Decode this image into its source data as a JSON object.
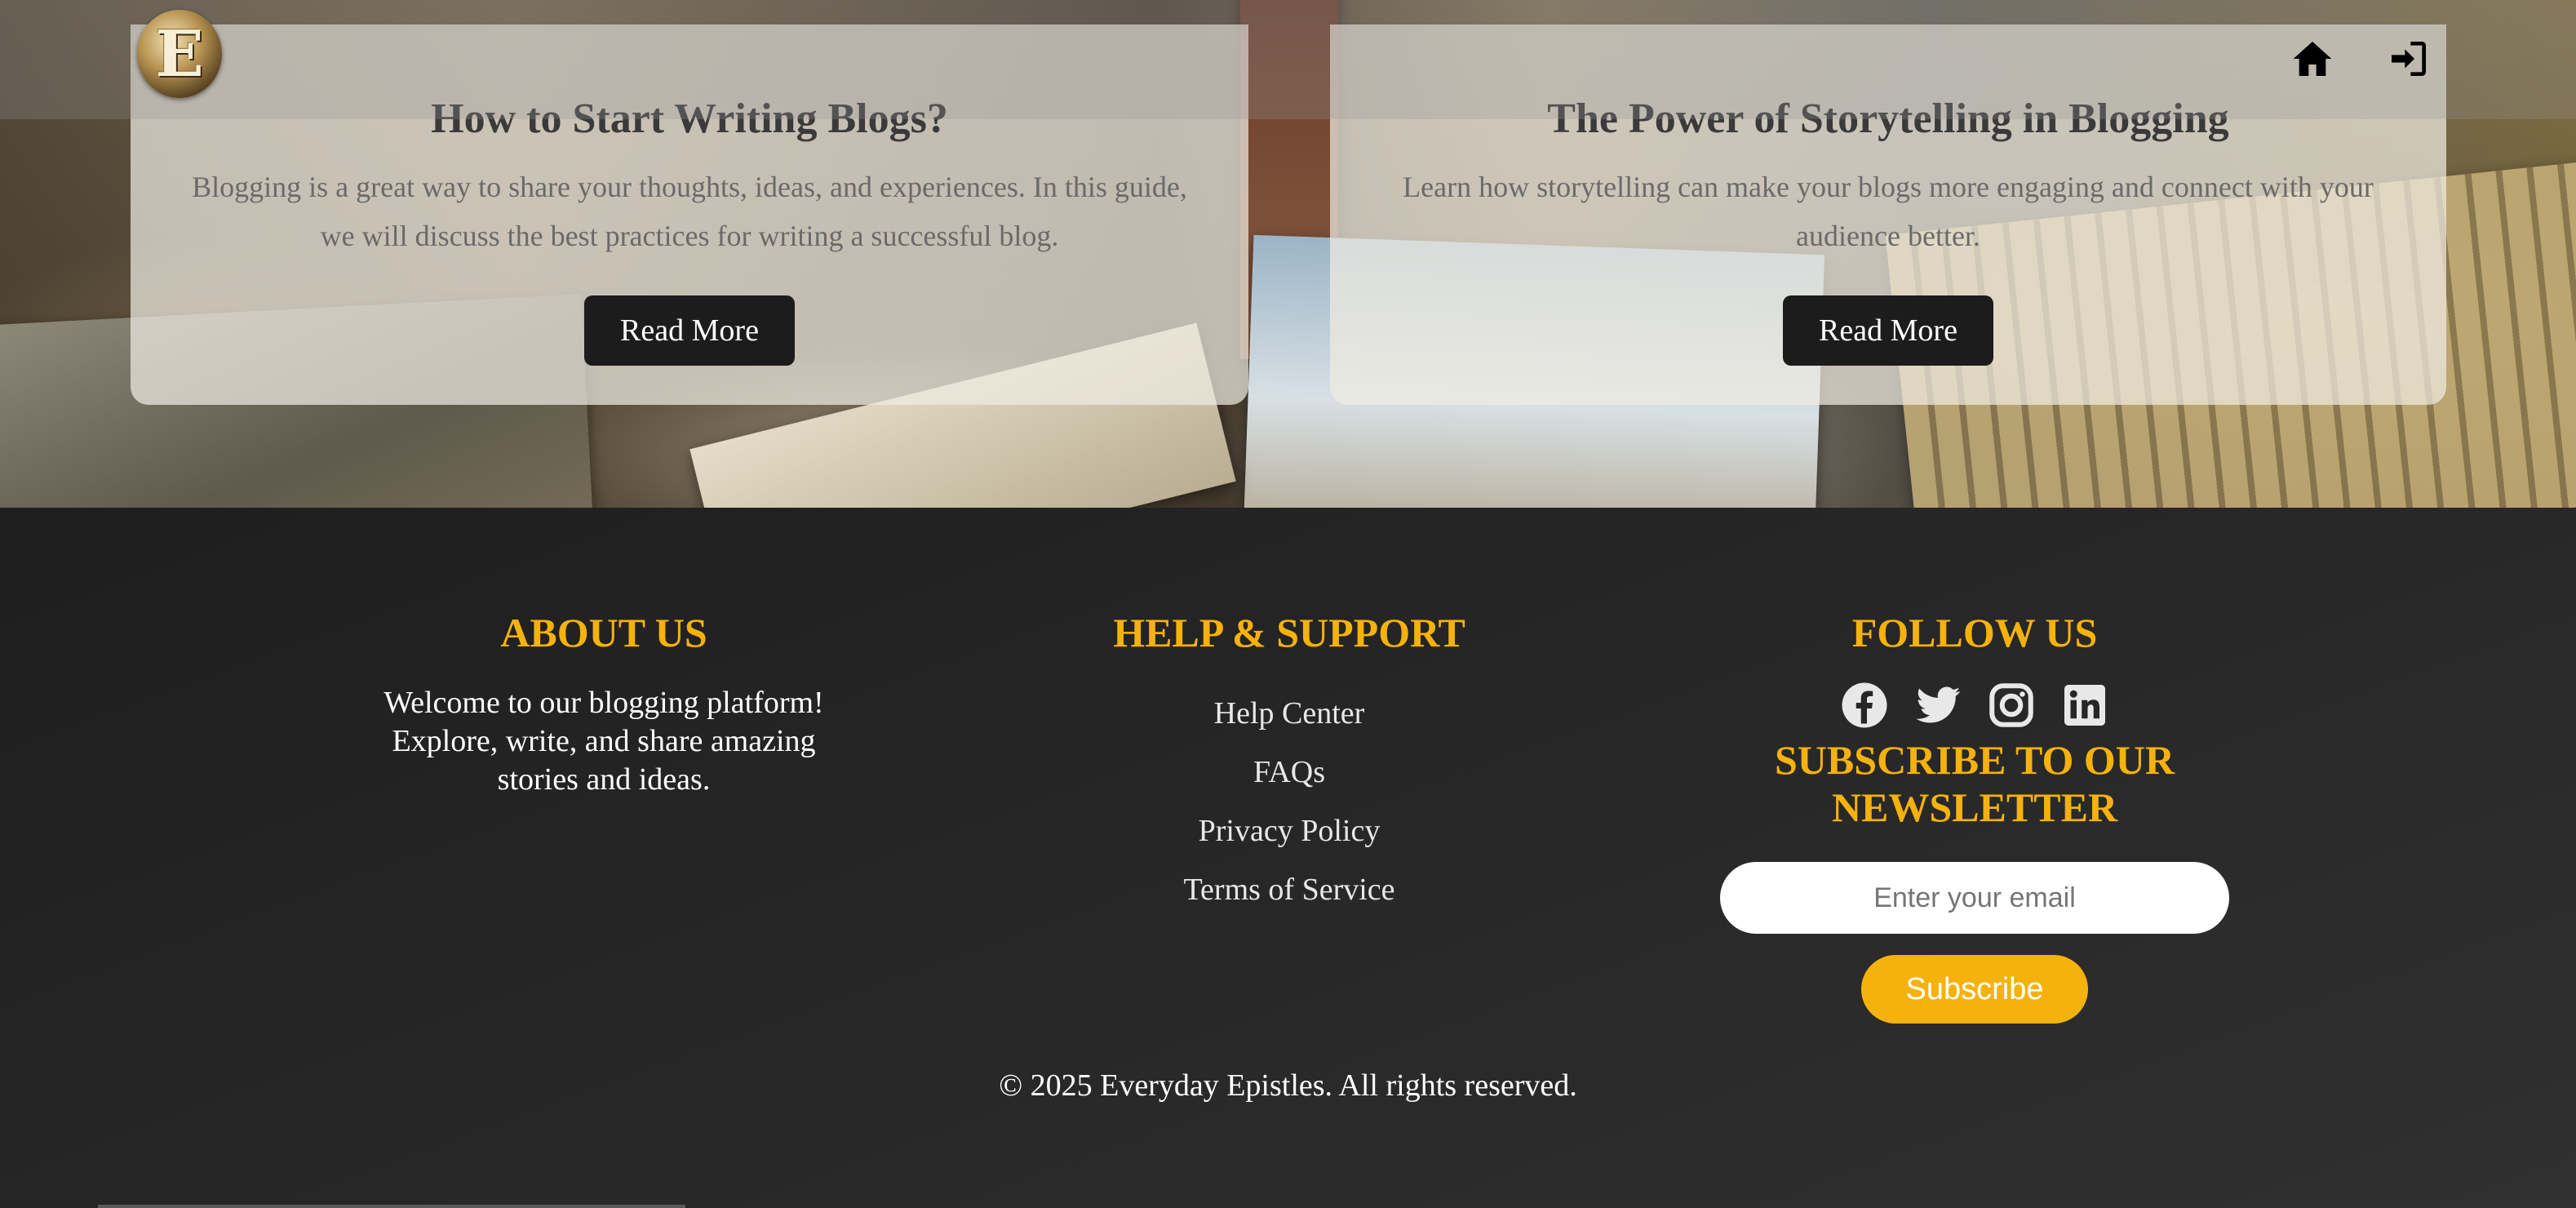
{
  "cards": [
    {
      "title": "How to Start Writing Blogs?",
      "excerpt": "Blogging is a great way to share your thoughts, ideas, and experiences. In this guide, we will discuss the best practices for writing a successful blog.",
      "button": "Read More"
    },
    {
      "title": "The Power of Storytelling in Blogging",
      "excerpt": "Learn how storytelling can make your blogs more engaging and connect with your audience better.",
      "button": "Read More"
    }
  ],
  "navbar": {
    "logo_letter": "E",
    "icons": [
      "home-icon",
      "sign-in-icon"
    ]
  },
  "footer": {
    "about": {
      "heading": "ABOUT US",
      "text": "Welcome to our blogging platform! Explore, write, and share amazing stories and ideas."
    },
    "help": {
      "heading": "HELP & SUPPORT",
      "links": [
        "Help Center",
        "FAQs",
        "Privacy Policy",
        "Terms of Service"
      ]
    },
    "follow": {
      "heading": "FOLLOW US",
      "socials": [
        "facebook-icon",
        "twitter-icon",
        "instagram-icon",
        "linkedin-icon"
      ],
      "newsletter_heading": "SUBSCRIBE TO OUR NEWSLETTER",
      "email_placeholder": "Enter your email",
      "subscribe_button": "Subscribe"
    },
    "copyright": "© 2025 Everyday Epistles. All rights reserved."
  },
  "colors": {
    "accent": "#f5b20d",
    "footer_bg": "#262626",
    "button_dark": "#1c1c1c"
  }
}
